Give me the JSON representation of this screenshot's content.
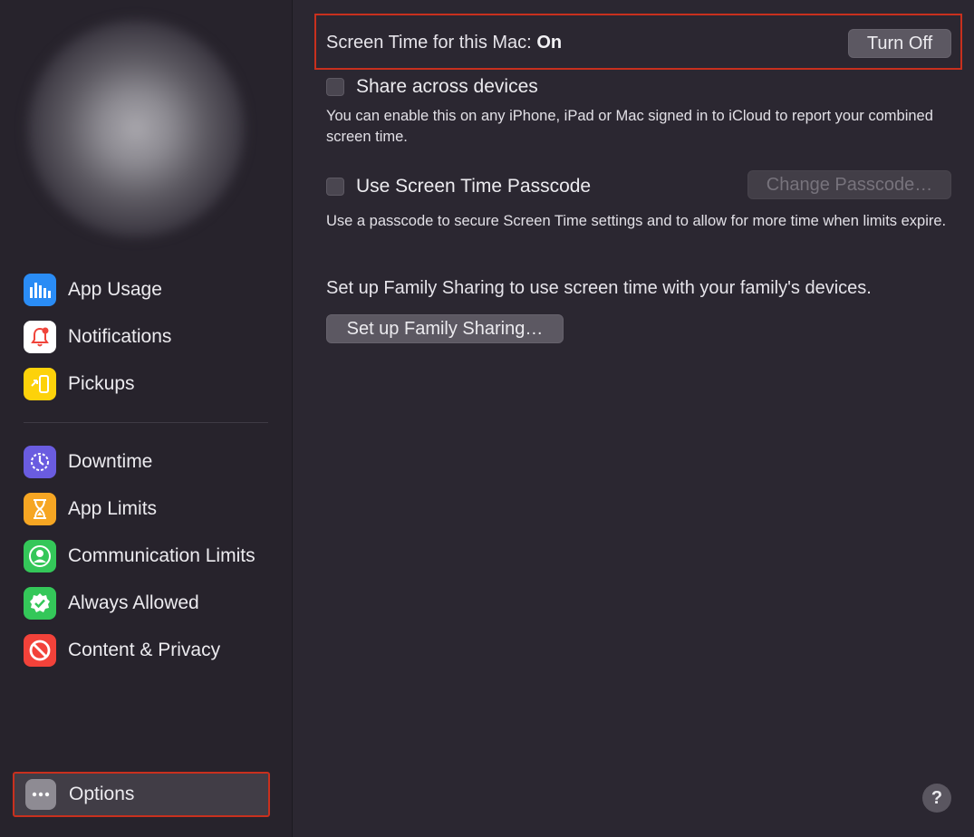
{
  "sidebar": {
    "items": [
      {
        "label": "App Usage",
        "icon": "bar-chart-icon",
        "color": "#2a8cf5"
      },
      {
        "label": "Notifications",
        "icon": "bell-icon",
        "color": "#ffffff"
      },
      {
        "label": "Pickups",
        "icon": "pickup-icon",
        "color": "#fdd20a"
      },
      {
        "label": "Downtime",
        "icon": "downtime-icon",
        "color": "#6a5ce0"
      },
      {
        "label": "App Limits",
        "icon": "hourglass-icon",
        "color": "#f6a623"
      },
      {
        "label": "Communication Limits",
        "icon": "person-icon",
        "color": "#34c759"
      },
      {
        "label": "Always Allowed",
        "icon": "checkmark-seal-icon",
        "color": "#34c759"
      },
      {
        "label": "Content & Privacy",
        "icon": "prohibited-icon",
        "color": "#f2423a"
      }
    ],
    "options": {
      "label": "Options",
      "icon": "ellipsis-icon",
      "color": "#8e8b93"
    }
  },
  "main": {
    "status_prefix": "Screen Time for this Mac:",
    "status_value": "On",
    "turn_off_label": "Turn Off",
    "share_label": "Share across devices",
    "share_desc": "You can enable this on any iPhone, iPad or Mac signed in to iCloud to report your combined screen time.",
    "passcode_label": "Use Screen Time Passcode",
    "change_passcode_label": "Change Passcode…",
    "passcode_desc": "Use a passcode to secure Screen Time settings and to allow for more time when limits expire.",
    "family_text": "Set up Family Sharing to use screen time with your family's devices.",
    "family_button_label": "Set up Family Sharing…",
    "help_label": "?"
  },
  "colors": {
    "highlight": "#c8301e",
    "background": "#2b2731"
  }
}
